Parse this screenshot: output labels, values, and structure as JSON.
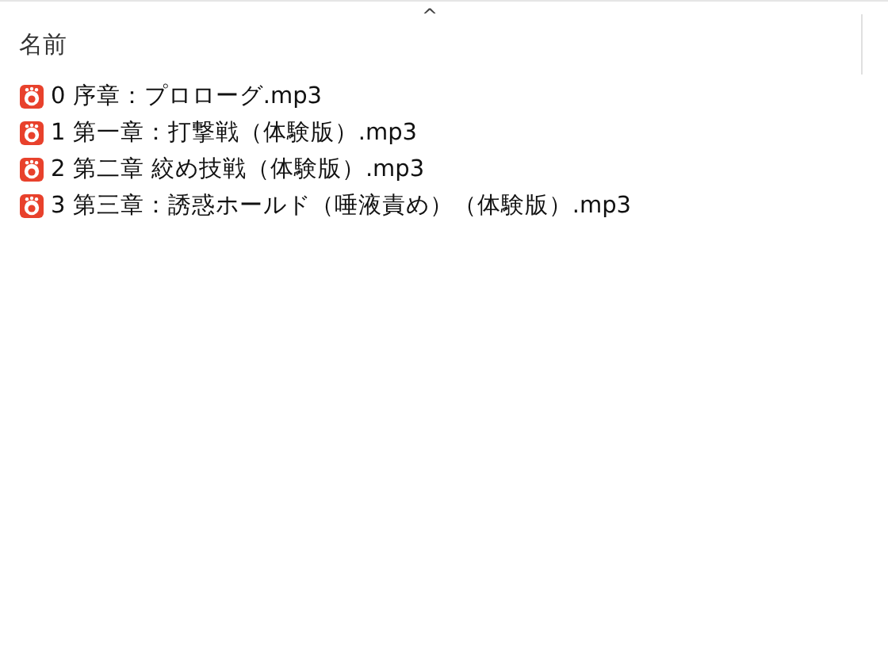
{
  "header": {
    "column_name": "名前",
    "sort_indicator": "^"
  },
  "files": [
    {
      "name": "0 序章：プロローグ.mp3"
    },
    {
      "name": "1 第一章：打撃戦（体験版）.mp3"
    },
    {
      "name": "2 第二章 絞め技戦（体験版）.mp3"
    },
    {
      "name": "3 第三章：誘惑ホールド（唾液責め）（体験版）.mp3"
    }
  ]
}
